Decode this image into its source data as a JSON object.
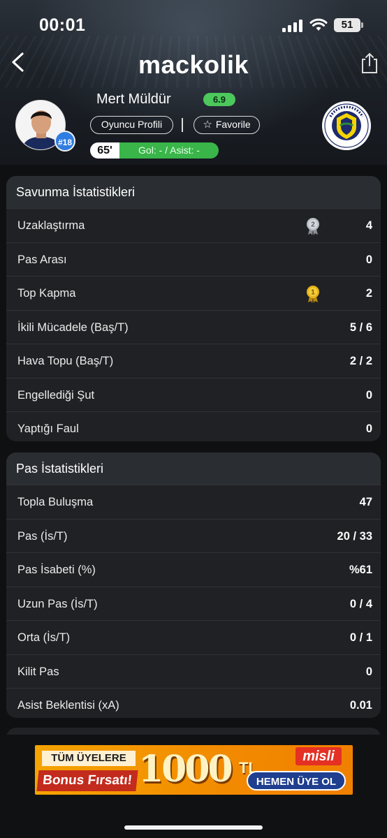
{
  "status_bar": {
    "time": "00:01",
    "battery": "51"
  },
  "app": {
    "brand": "mackolik"
  },
  "player": {
    "name": "Mert Müldür",
    "rating": "6.9",
    "number": "#18",
    "profile_label": "Oyuncu Profili",
    "favorite_label": "Favorile",
    "minute": "65'",
    "goal_assist": "Gol: - / Asist: -"
  },
  "colors": {
    "rating_green": "#4cc95c",
    "goal_green": "#39b54a",
    "badge_blue": "#2f7de1",
    "card_bg": "#1f2124"
  },
  "defense": {
    "title": "Savunma İstatistikleri",
    "rows": [
      {
        "label": "Uzaklaştırma",
        "value": "4",
        "medal": "2"
      },
      {
        "label": "Pas Arası",
        "value": "0"
      },
      {
        "label": "Top Kapma",
        "value": "2",
        "medal": "1"
      },
      {
        "label": "İkili Mücadele (Baş/T)",
        "value": "5 / 6"
      },
      {
        "label": "Hava Topu (Baş/T)",
        "value": "2 / 2"
      },
      {
        "label": "Engellediği Şut",
        "value": "0"
      },
      {
        "label": "Yaptığı Faul",
        "value": "0"
      }
    ]
  },
  "passing": {
    "title": "Pas İstatistikleri",
    "rows": [
      {
        "label": "Topla Buluşma",
        "value": "47"
      },
      {
        "label": "Pas (İs/T)",
        "value": "20 / 33"
      },
      {
        "label": "Pas İsabeti (%)",
        "value": "%61"
      },
      {
        "label": "Uzun Pas (İs/T)",
        "value": "0 / 4"
      },
      {
        "label": "Orta (İs/T)",
        "value": "0 / 1"
      },
      {
        "label": "Kilit Pas",
        "value": "0"
      },
      {
        "label": "Asist Beklentisi (xA)",
        "value": "0.01"
      }
    ]
  },
  "ad": {
    "line1": "TÜM ÜYELERE",
    "line2": "Bonus Fırsatı!",
    "amount": "1000",
    "currency": "TL",
    "brand": "misli",
    "cta": "HEMEN ÜYE OL"
  }
}
